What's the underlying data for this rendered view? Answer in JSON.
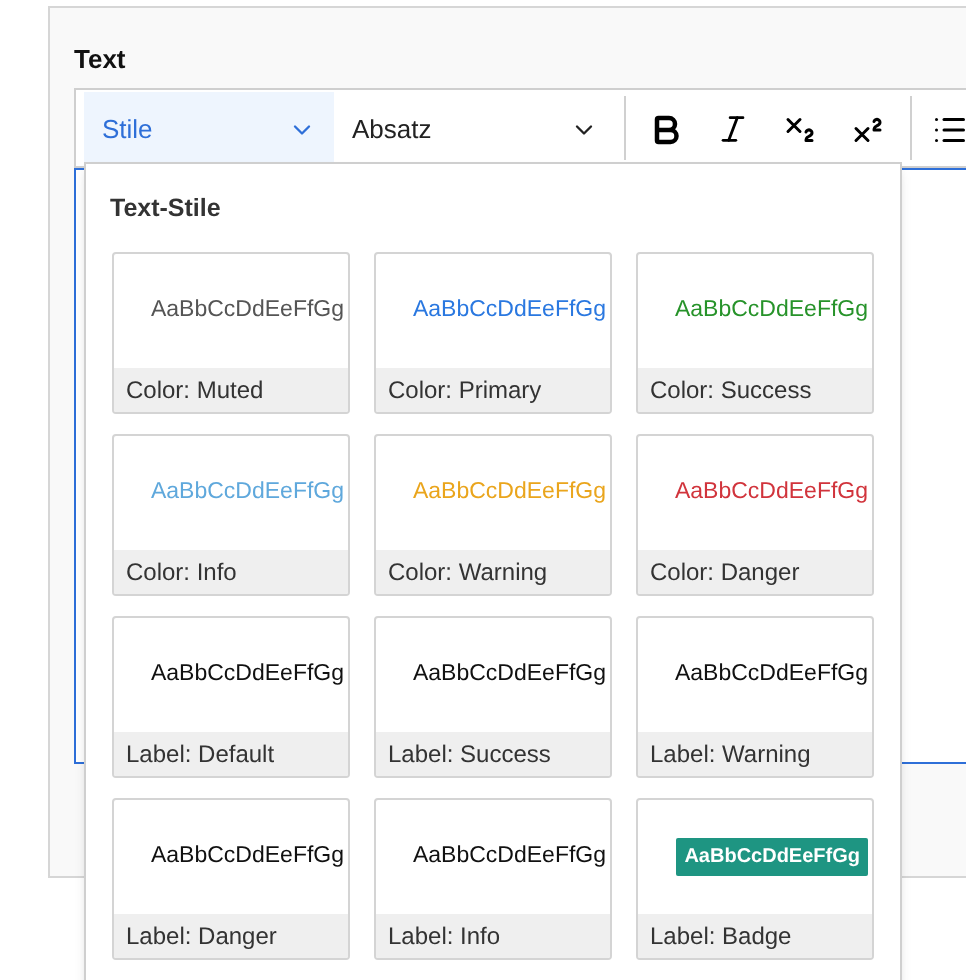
{
  "field": {
    "label": "Text"
  },
  "toolbar": {
    "style_dropdown": {
      "label": "Stile",
      "expanded": true
    },
    "format_dropdown": {
      "label": "Absatz",
      "expanded": false
    }
  },
  "style_menu": {
    "heading": "Text-Stile",
    "styles": [
      {
        "kind": "text",
        "preview": "AaBbCcDdEeFfGg",
        "label": "Color: Muted",
        "color": "#555555"
      },
      {
        "kind": "text",
        "preview": "AaBbCcDdEeFfGg",
        "label": "Color: Primary",
        "color": "#2a78e0"
      },
      {
        "kind": "text",
        "preview": "AaBbCcDdEeFfGg",
        "label": "Color: Success",
        "color": "#27932a"
      },
      {
        "kind": "text",
        "preview": "AaBbCcDdEeFfGg",
        "label": "Color: Info",
        "color": "#5fa8dc"
      },
      {
        "kind": "text",
        "preview": "AaBbCcDdEeFfGg",
        "label": "Color: Warning",
        "color": "#eaa51c"
      },
      {
        "kind": "text",
        "preview": "AaBbCcDdEeFfGg",
        "label": "Color: Danger",
        "color": "#d1343c"
      },
      {
        "kind": "text",
        "preview": "AaBbCcDdEeFfGg",
        "label": "Label: Default",
        "color": "#111111"
      },
      {
        "kind": "text",
        "preview": "AaBbCcDdEeFfGg",
        "label": "Label: Success",
        "color": "#111111"
      },
      {
        "kind": "text",
        "preview": "AaBbCcDdEeFfGg",
        "label": "Label: Warning",
        "color": "#111111"
      },
      {
        "kind": "text",
        "preview": "AaBbCcDdEeFfGg",
        "label": "Label: Danger",
        "color": "#111111"
      },
      {
        "kind": "text",
        "preview": "AaBbCcDdEeFfGg",
        "label": "Label: Info",
        "color": "#111111"
      },
      {
        "kind": "badge",
        "preview": "AaBbCcDdEeFfGg",
        "label": "Label: Badge",
        "color": "#1e9582"
      }
    ]
  }
}
